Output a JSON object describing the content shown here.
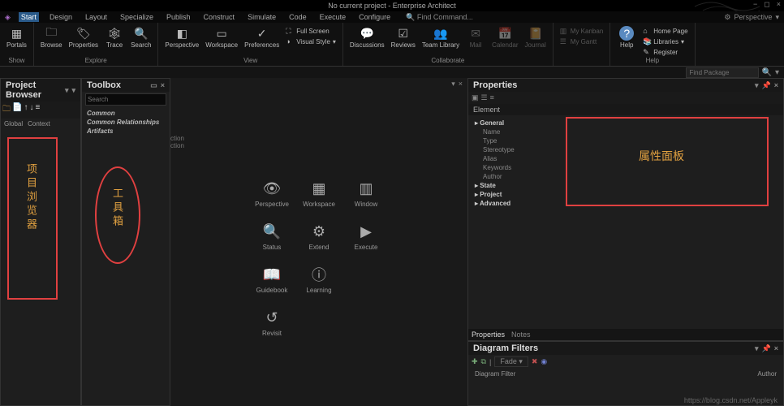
{
  "title": "No current project - Enterprise Architect",
  "menubar": [
    "Start",
    "Design",
    "Layout",
    "Specialize",
    "Publish",
    "Construct",
    "Simulate",
    "Code",
    "Execute",
    "Configure"
  ],
  "menubar_right": "Perspective",
  "findcmd": "Find Command...",
  "ribbon": {
    "show": {
      "label": "Show",
      "items": [
        {
          "label": "Portals"
        }
      ]
    },
    "explore": {
      "label": "Explore",
      "items": [
        {
          "label": "Browse"
        },
        {
          "label": "Properties"
        },
        {
          "label": "Trace"
        },
        {
          "label": "Search"
        }
      ]
    },
    "view": {
      "label": "View",
      "items": [
        {
          "label": "Perspective"
        },
        {
          "label": "Workspace"
        },
        {
          "label": "Preferences"
        }
      ],
      "small": [
        {
          "label": "Full Screen"
        },
        {
          "label": "Visual Style"
        }
      ]
    },
    "collab": {
      "label": "Collaborate",
      "items": [
        {
          "label": "Discussions"
        },
        {
          "label": "Reviews"
        },
        {
          "label": "Team Library"
        },
        {
          "label": "Mail"
        },
        {
          "label": "Calendar"
        },
        {
          "label": "Journal"
        }
      ]
    },
    "pers": {
      "label": "",
      "small": [
        {
          "label": "My Kanban"
        },
        {
          "label": "My Gantt"
        }
      ]
    },
    "help": {
      "label": "Help",
      "items": [
        {
          "label": "Help"
        }
      ],
      "small": [
        {
          "label": "Home Page"
        },
        {
          "label": "Libraries"
        },
        {
          "label": "Register"
        }
      ]
    }
  },
  "findpkg_placeholder": "Find Package",
  "project_browser": {
    "title": "Project Browser",
    "tabs": [
      "Global",
      "Context"
    ],
    "annotation": "项目浏览器"
  },
  "toolbox": {
    "title": "Toolbox",
    "search_placeholder": "Search",
    "cats": [
      "Common",
      "Common Relationships",
      "Artifacts"
    ],
    "annotation": "工具箱",
    "frags": [
      "ction",
      "ction"
    ]
  },
  "center_grid": [
    {
      "label": "Perspective"
    },
    {
      "label": "Workspace"
    },
    {
      "label": "Window"
    },
    {
      "label": "Status"
    },
    {
      "label": "Extend"
    },
    {
      "label": "Execute"
    },
    {
      "label": "Guidebook"
    },
    {
      "label": "Learning"
    },
    {
      "label": ""
    },
    {
      "label": "Revisit"
    },
    {
      "label": ""
    },
    {
      "label": ""
    }
  ],
  "properties": {
    "title": "Properties",
    "subtab": "Element",
    "annotation": "属性面板",
    "rows": [
      {
        "k": "General",
        "hdr": true
      },
      {
        "k": "Name"
      },
      {
        "k": "Type"
      },
      {
        "k": "Stereotype"
      },
      {
        "k": "Alias"
      },
      {
        "k": "Keywords"
      },
      {
        "k": "Author"
      },
      {
        "k": "State",
        "hdr": true
      },
      {
        "k": "Project",
        "hdr": true
      },
      {
        "k": "Advanced",
        "hdr": true
      }
    ],
    "tabs2": [
      "Properties",
      "Notes"
    ]
  },
  "diagram_filters": {
    "title": "Diagram Filters",
    "fade": "Fade",
    "cols": [
      "Diagram Filter",
      "Author"
    ]
  },
  "watermark": "https://blog.csdn.net/Appleyk"
}
